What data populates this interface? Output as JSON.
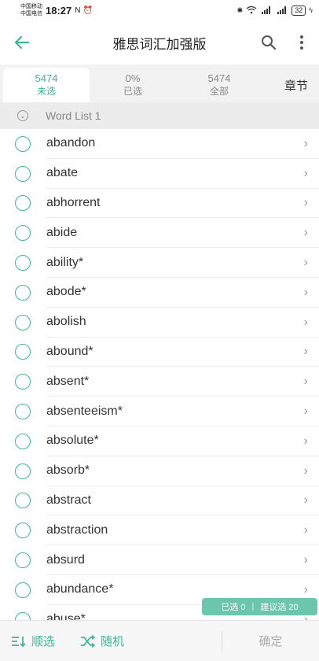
{
  "status_bar": {
    "carrier1": "中国移动",
    "carrier2": "中国电信",
    "time": "18:27",
    "battery": "32"
  },
  "header": {
    "title": "雅思词汇加强版"
  },
  "tabs": [
    {
      "num": "5474",
      "label": "未选"
    },
    {
      "num": "0%",
      "label": "已选"
    },
    {
      "num": "5474",
      "label": "全部"
    }
  ],
  "chapter_label": "章节",
  "section": {
    "title": "Word List 1"
  },
  "words": [
    "abandon",
    "abate",
    "abhorrent",
    "abide",
    "ability*",
    "abode*",
    "abolish",
    "abound*",
    "absent*",
    "absenteeism*",
    "absolute*",
    "absorb*",
    "abstract",
    "abstraction",
    "absurd",
    "abundance*",
    "abuse*"
  ],
  "counter": {
    "selected": "已选 0",
    "separator": "|",
    "suggested": "建议选 20"
  },
  "bottom_bar": {
    "sequential": "顺选",
    "random": "随机",
    "confirm": "确定"
  },
  "colors": {
    "accent": "#3fb595",
    "counter_bg": "#6cc6ac"
  }
}
